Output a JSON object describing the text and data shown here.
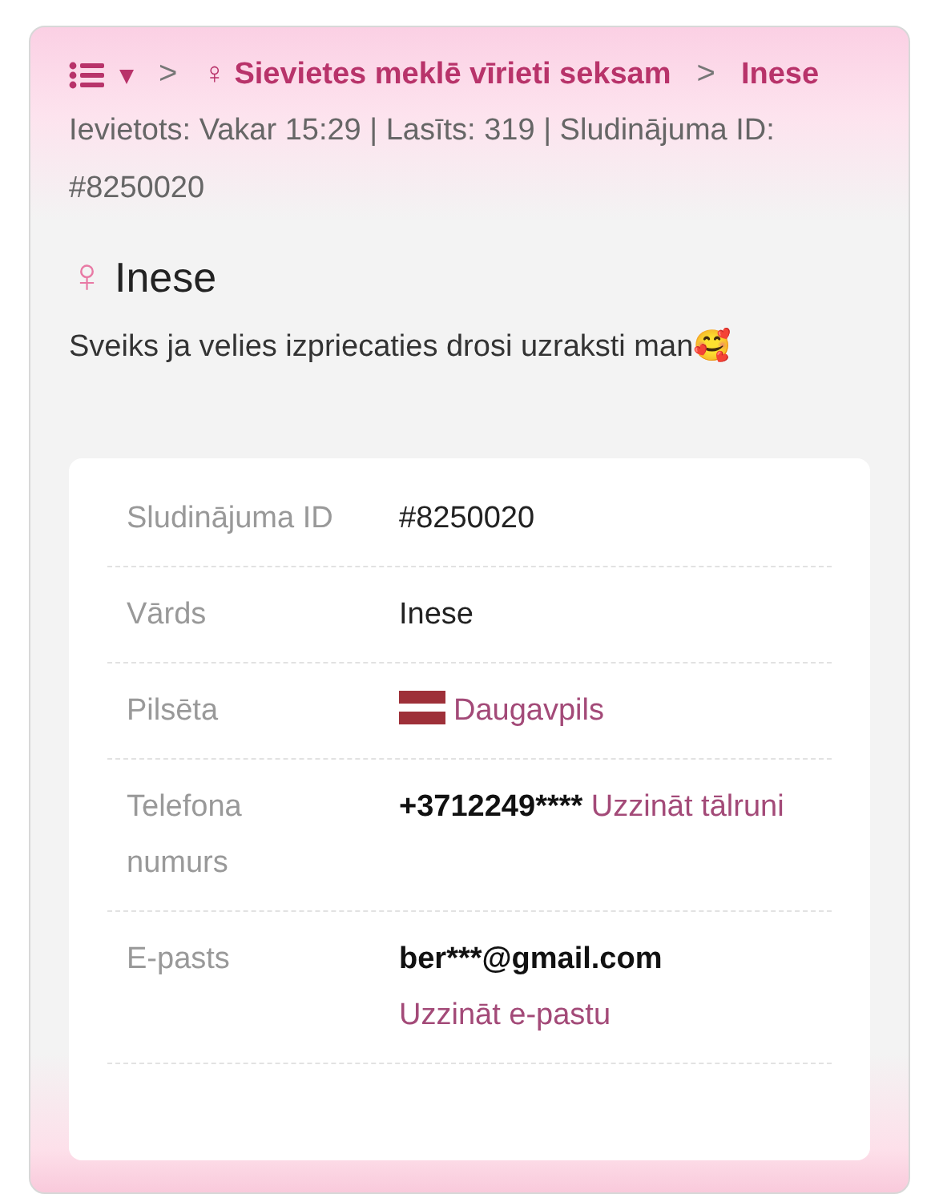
{
  "breadcrumb": {
    "menu_caret": "▾",
    "separator": ">",
    "category_symbol": "♀",
    "category": "Sievietes meklē vīrieti seksam",
    "current": "Inese"
  },
  "meta": "Ievietots: Vakar 15:29 | Lasīts: 319 | Sludinājuma ID: #8250020",
  "title": {
    "symbol": "♀",
    "name": "Inese"
  },
  "message": "Sveiks ja velies izpriecaties drosi uzraksti man🥰",
  "details": [
    {
      "kind": "text",
      "label": "Sludinājuma ID",
      "value": "#8250020"
    },
    {
      "kind": "text",
      "label": "Vārds",
      "value": "Inese"
    },
    {
      "kind": "city",
      "label": "Pilsēta",
      "value": "Daugavpils"
    },
    {
      "kind": "contact",
      "label": "Telefona numurs",
      "value": "+3712249****",
      "link": "Uzzināt tālruni"
    },
    {
      "kind": "contact",
      "label": "E-pasts",
      "value": "ber***@gmail.com",
      "link": "Uzzināt e-pastu"
    }
  ]
}
